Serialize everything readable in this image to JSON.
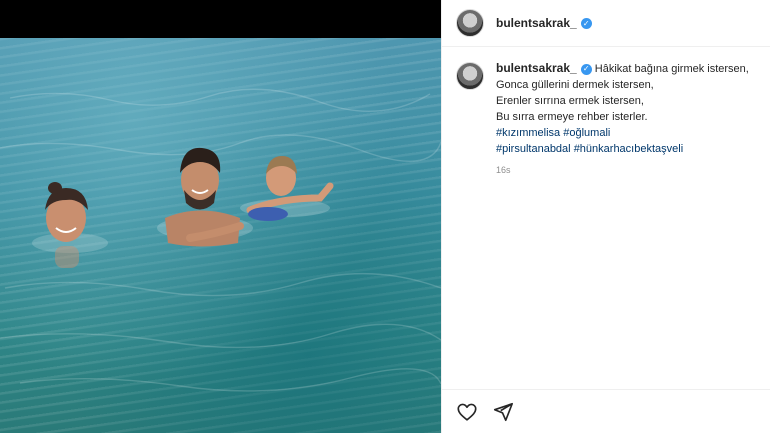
{
  "post": {
    "username": "bulentsakrak_",
    "caption_lines": [
      "Hâkikat bağına girmek istersen,",
      "Gonca güllerini dermek istersen,",
      "Erenler sırrına ermek istersen,",
      "Bu sırra ermeye rehber isterler."
    ],
    "hashtags": [
      "#kızımmelisa",
      "#oğlumali",
      "#pirsultanabdal",
      "#hünkarhacıbektaşveli"
    ],
    "time_ago": "16s"
  },
  "icons": {
    "verified": "verified-badge-icon",
    "like": "heart-icon",
    "share": "send-icon"
  },
  "colors": {
    "accent": "#3897f0",
    "hashtag": "#00376b"
  }
}
